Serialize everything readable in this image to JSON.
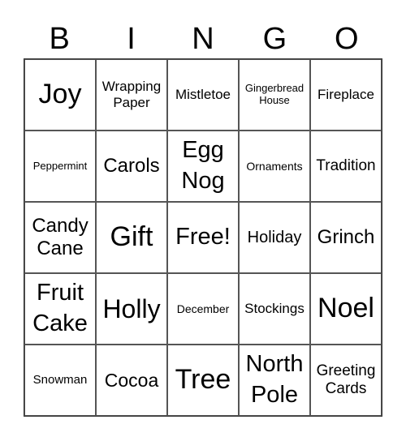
{
  "header": [
    "B",
    "I",
    "N",
    "G",
    "O"
  ],
  "cells": [
    "Joy",
    "Wrapping Paper",
    "Mistletoe",
    "Gingerbread House",
    "Fireplace",
    "Peppermint",
    "Carols",
    "Egg Nog",
    "Ornaments",
    "Tradition",
    "Candy Cane",
    "Gift",
    "Free!",
    "Holiday",
    "Grinch",
    "Fruit Cake",
    "Holly",
    "December",
    "Stockings",
    "Noel",
    "Snowman",
    "Cocoa",
    "Tree",
    "North Pole",
    "Greeting Cards"
  ]
}
